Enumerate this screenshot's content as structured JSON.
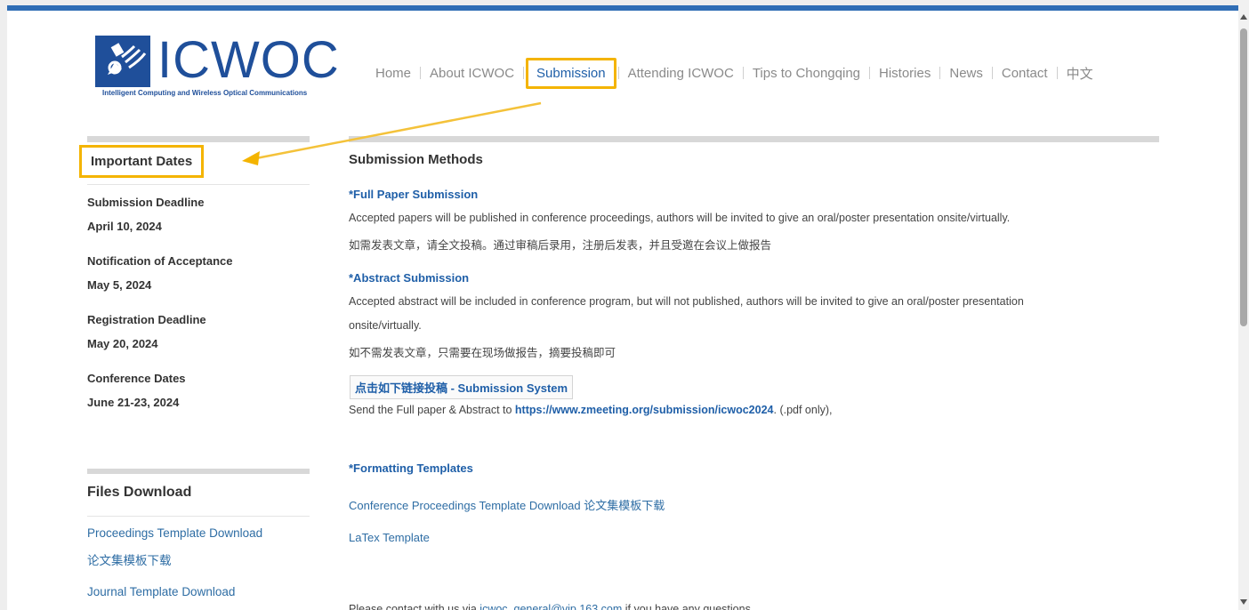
{
  "header": {
    "logo_text": "ICWOC",
    "logo_subtitle": "Intelligent Computing and Wireless Optical Communications",
    "nav": [
      {
        "label": "Home"
      },
      {
        "label": "About ICWOC"
      },
      {
        "label": "Submission",
        "active": true
      },
      {
        "label": "Attending ICWOC"
      },
      {
        "label": "Tips to Chongqing"
      },
      {
        "label": "Histories"
      },
      {
        "label": "News"
      },
      {
        "label": "Contact"
      },
      {
        "label": "中文"
      }
    ]
  },
  "sidebar": {
    "dates_title": "Important Dates",
    "dates": [
      {
        "label": "Submission Deadline",
        "value": "April 10, 2024"
      },
      {
        "label": "Notification of Acceptance",
        "value": "May 5, 2024"
      },
      {
        "label": "Registration Deadline",
        "value": "May 20, 2024"
      },
      {
        "label": "Conference Dates",
        "value": "June 21-23, 2024"
      }
    ],
    "files_title": "Files Download",
    "files": [
      {
        "label": "Proceedings Template Download"
      },
      {
        "label": "论文集模板下载"
      },
      {
        "label": "Journal Template Download"
      }
    ]
  },
  "main": {
    "title": "Submission Methods",
    "full_paper": {
      "heading": "*Full Paper Submission",
      "text_en": "Accepted papers will be published in conference proceedings, authors will be invited to give an oral/poster presentation onsite/virtually.",
      "text_cn": "如需发表文章，请全文投稿。通过审稿后录用，注册后发表，并且受邀在会议上做报告"
    },
    "abstract": {
      "heading": "*Abstract Submission",
      "text_en_1": "Accepted abstract will be included in conference program, but will not published, authors will be invited to give an oral/poster presentation",
      "text_en_2": "onsite/virtually.",
      "text_cn": "如不需发表文章，只需要在现场做报告，摘要投稿即可"
    },
    "system_button": "点击如下链接投稿 - Submission System",
    "send_prefix": "Send the Full paper & Abstract to ",
    "send_link": "https://www.zmeeting.org/submission/icwoc2024",
    "send_suffix": ". (.pdf only),",
    "templates": {
      "heading": "*Formatting Templates",
      "items": [
        {
          "label": "Conference Proceedings Template Download 论文集模板下载"
        },
        {
          "label": "LaTex Template"
        }
      ]
    },
    "contact": {
      "prefix": "Please contact with us via ",
      "email": "icwoc_general@vip.163.com",
      "suffix": " if you have any questions."
    }
  },
  "colors": {
    "accent": "#1f5fa8",
    "highlight": "#f4b400",
    "brand": "#1f4f9a"
  }
}
